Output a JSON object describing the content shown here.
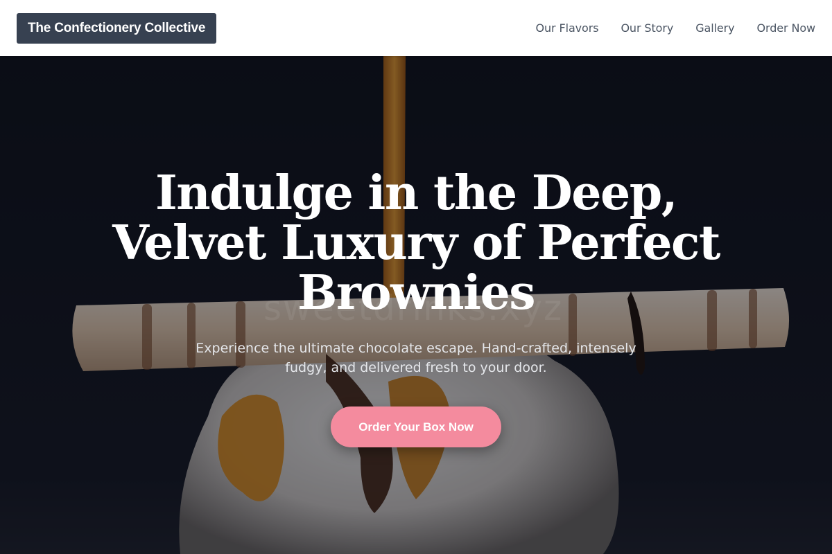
{
  "header": {
    "brand": "The Confectionery Collective",
    "nav": [
      {
        "label": "Our Flavors"
      },
      {
        "label": "Our Story"
      },
      {
        "label": "Gallery"
      },
      {
        "label": "Order Now"
      }
    ]
  },
  "hero": {
    "title": "Indulge in the Deep, Velvet Luxury of Perfect Brownies",
    "subtitle": "Experience the ultimate chocolate escape. Hand-crafted, intensely fudgy, and delivered fresh to your door.",
    "cta_label": "Order Your Box Now",
    "watermark": "sweetdrinks.xyz",
    "image": "dessert-photo"
  },
  "colors": {
    "brand_bg": "#374151",
    "nav_text": "#4b5563",
    "cta": "#f48b9e",
    "hero_bg": "#0b0e16"
  }
}
